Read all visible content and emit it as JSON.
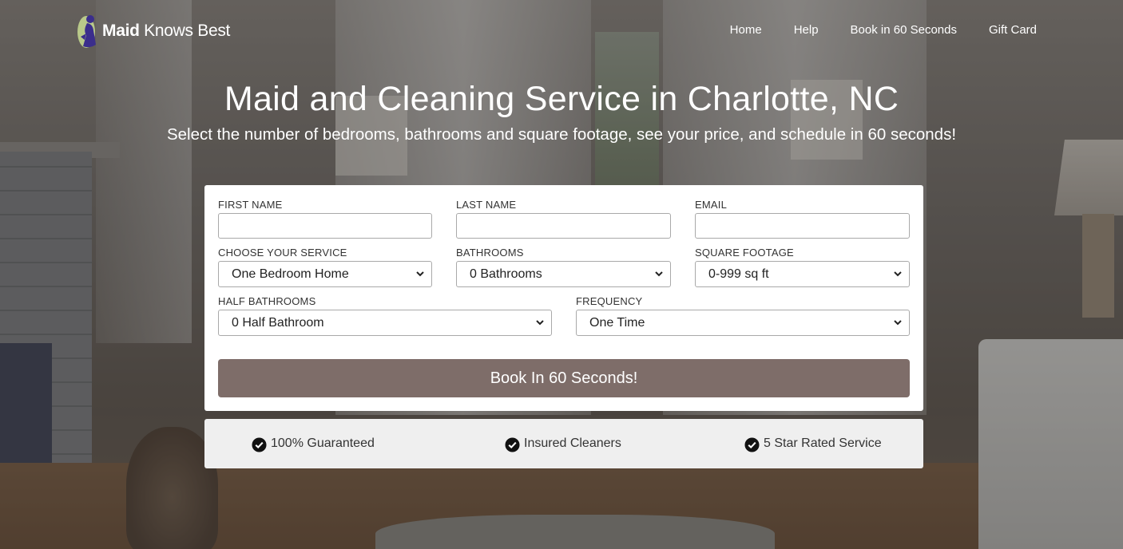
{
  "brand": {
    "name_bold": "Maid",
    "name_light": " Knows Best",
    "colors": {
      "logo_purple": "#3b2e8c",
      "logo_green": "#b9c98a"
    }
  },
  "nav": {
    "items": [
      {
        "label": "Home"
      },
      {
        "label": "Help"
      },
      {
        "label": "Book in 60 Seconds"
      },
      {
        "label": "Gift Card"
      }
    ]
  },
  "hero": {
    "title": "Maid and Cleaning Service in Charlotte, NC",
    "subtitle": "Select the number of bedrooms, bathrooms and square footage, see your price, and schedule in 60 seconds!"
  },
  "form": {
    "first_name": {
      "label": "FIRST NAME",
      "value": ""
    },
    "last_name": {
      "label": "LAST NAME",
      "value": ""
    },
    "email": {
      "label": "EMAIL",
      "value": ""
    },
    "service": {
      "label": "CHOOSE YOUR SERVICE",
      "selected": "One Bedroom Home"
    },
    "bathrooms": {
      "label": "BATHROOMS",
      "selected": "0 Bathrooms"
    },
    "square_footage": {
      "label": "SQUARE FOOTAGE",
      "selected": "0-999 sq ft"
    },
    "half_bathrooms": {
      "label": "HALF BATHROOMS",
      "selected": "0 Half Bathroom"
    },
    "frequency": {
      "label": "FREQUENCY",
      "selected": "One Time"
    },
    "submit_label": "Book In 60 Seconds!",
    "button_color": "#7e6d69"
  },
  "features": [
    {
      "icon": "check-circle-icon",
      "label": "100% Guaranteed"
    },
    {
      "icon": "check-circle-icon",
      "label": "Insured Cleaners"
    },
    {
      "icon": "check-circle-icon",
      "label": "5 Star Rated Service"
    }
  ]
}
